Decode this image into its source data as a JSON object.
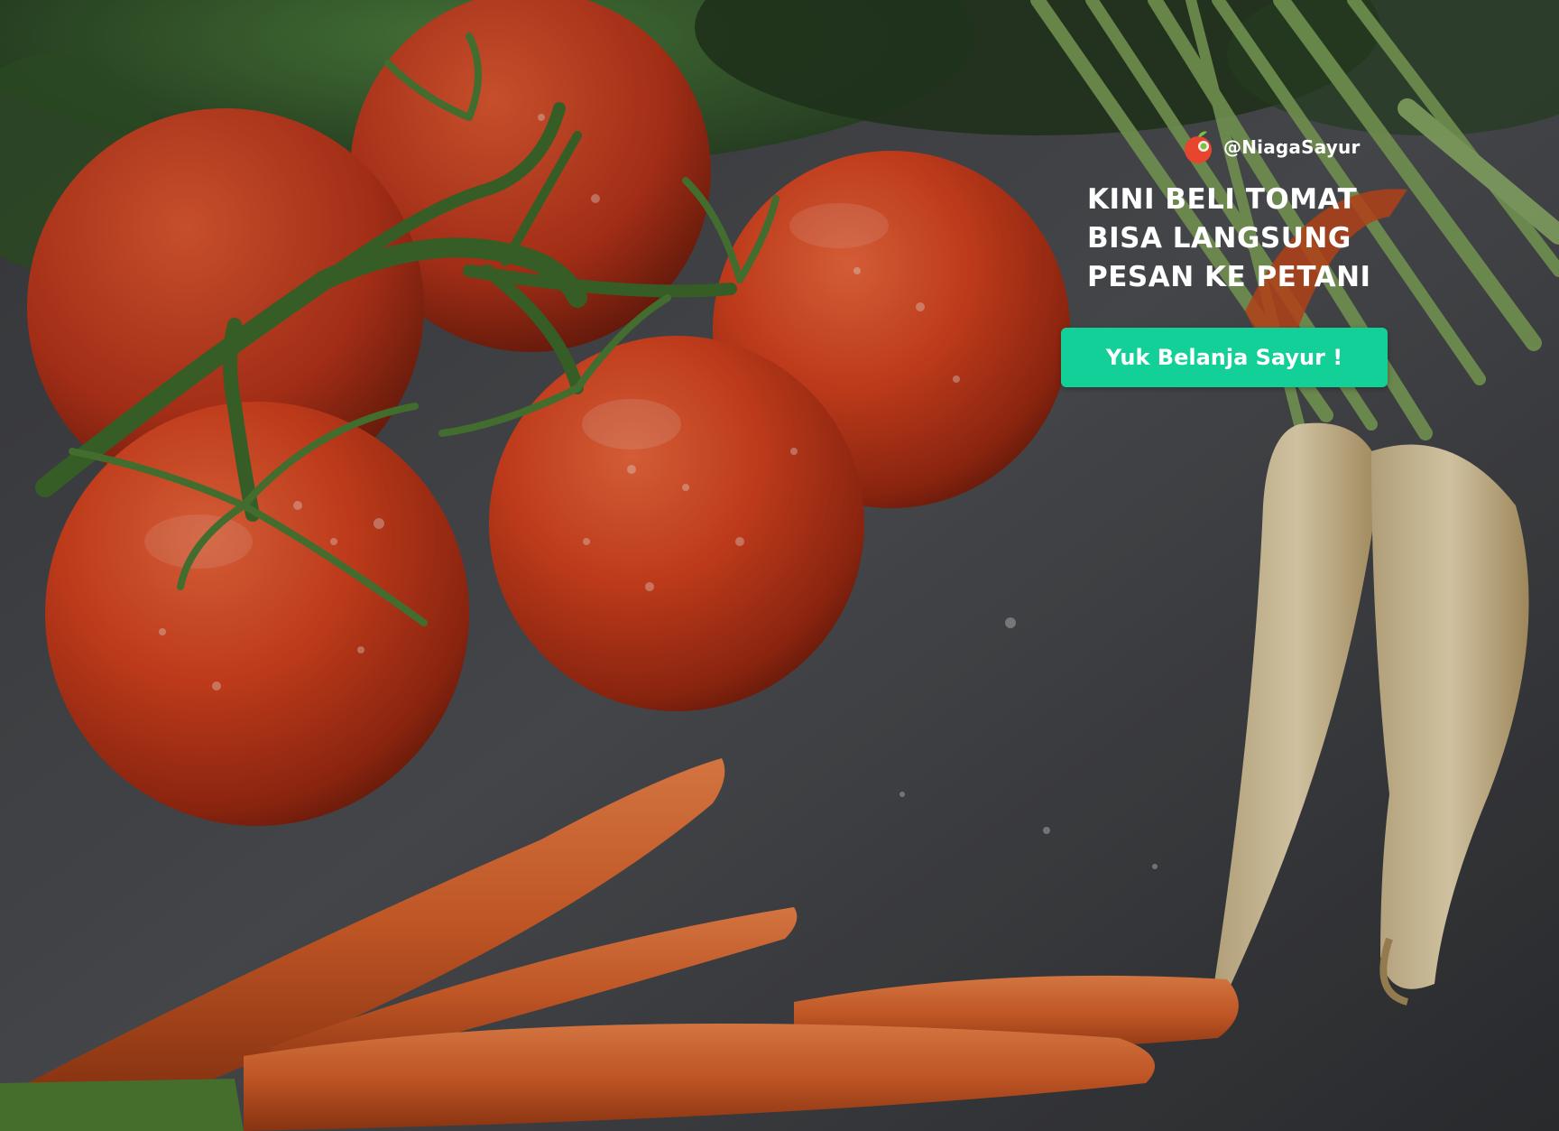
{
  "brand": {
    "handle": "@NiagaSayur",
    "logo_icon": "tomato-logo-icon",
    "logo_color": "#e8452e",
    "logo_accent": "#7bc142"
  },
  "headline": {
    "lines": [
      "KINI BELI TOMAT",
      "BISA LANGSUNG",
      "PESAN KE PETANI"
    ]
  },
  "cta": {
    "label": "Yuk Belanja Sayur !",
    "color": "#13cf98"
  },
  "scene": {
    "subjects": [
      "tomato",
      "carrot",
      "parsnip"
    ],
    "background_color": "#2b2d30"
  }
}
